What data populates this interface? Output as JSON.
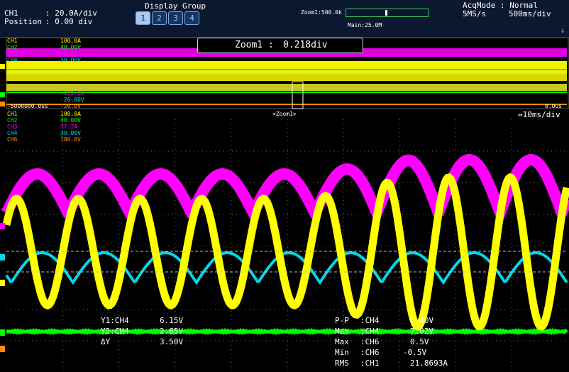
{
  "header": {
    "channel": "CH1",
    "channel_scale": ": 20.0A/div",
    "position_label": "Position",
    "position_value": ": 0.00 div",
    "display_group_label": "Display Group",
    "groups": [
      "1",
      "2",
      "3",
      "4"
    ],
    "active_group": "1",
    "zoom_rate": "Zoom1:500.0k",
    "main_rate": "Main:25.0M",
    "acq_mode": "AcqMode : Normal",
    "sample_rate": "5MS/s",
    "time_div": "500ms/div",
    "zoom_position_fraction": 0.49
  },
  "zoom_window": {
    "label": "Zoom1 :",
    "value": "0.218div"
  },
  "main_panel": {
    "channels": [
      {
        "name": "CH1",
        "scale": "100.0A",
        "color": "#ffff00"
      },
      {
        "name": "CH2",
        "scale": "40.00V",
        "color": "#00ff00"
      },
      {
        "name": "CH3",
        "scale": "77.2A",
        "color": "#ff00ff"
      },
      {
        "name": "CH4",
        "scale": "30.00V",
        "color": "#00d8e8"
      }
    ],
    "extra_labels": [
      "-122.8A",
      "-20.00V",
      "-20.0V"
    ],
    "left_time": "-5000000.0us",
    "right_time": "0.0us",
    "zoom_marker": "<Zoom1>"
  },
  "zoom_panel": {
    "time_div": "↔10ms/div",
    "channels": [
      {
        "name": "CH1",
        "scale": "100.0A",
        "color": "#ffff00"
      },
      {
        "name": "CH2",
        "scale": "40.00V",
        "color": "#00ff00"
      },
      {
        "name": "CH3",
        "scale": "77.2A",
        "color": "#ff00ff"
      },
      {
        "name": "CH4",
        "scale": "30.00V",
        "color": "#00d8e8"
      },
      {
        "name": "CH6",
        "scale": "180.0V",
        "color": "#ff8c00"
      }
    ]
  },
  "cursors": {
    "y1": {
      "label": "Y1:CH4",
      "value": "6.15V"
    },
    "y2": {
      "label": "Y2:CH4",
      "value": "2.65V"
    },
    "dy": {
      "label": "ΔY",
      "value": "3.50V"
    }
  },
  "measurements": [
    {
      "item": "P-P",
      "channel": ":CH4",
      "value": "6.40V"
    },
    {
      "item": "Max",
      "channel": ":CH4",
      "value": "7.02V"
    },
    {
      "item": "Max",
      "channel": ":CH6",
      "value": "0.5V"
    },
    {
      "item": "Min",
      "channel": ":CH6",
      "value": "-0.5V"
    },
    {
      "item": "RMS",
      "channel": ":CH1",
      "value": "21.8693A"
    }
  ],
  "colors": {
    "ch1": "#ffff00",
    "ch2": "#00ff00",
    "ch3": "#ff00ff",
    "ch4": "#00d8e8",
    "ch6": "#ff8c00",
    "header_bg": "#0c1830",
    "grid": "#6a6a6a"
  }
}
